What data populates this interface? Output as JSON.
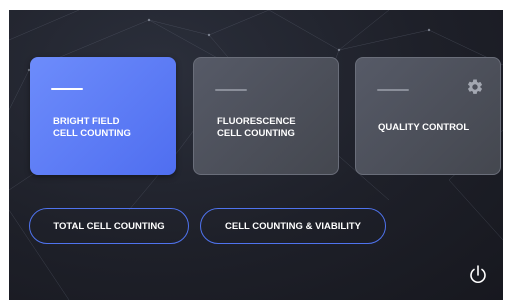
{
  "tiles": [
    {
      "label": "BRIGHT FIELD\nCELL COUNTING",
      "selected": true
    },
    {
      "label": "FLUORESCENCE\nCELL COUNTING",
      "selected": false
    },
    {
      "label": "QUALITY CONTROL",
      "selected": false,
      "icon": "gear-icon"
    }
  ],
  "buttons": {
    "total_cell_counting": "TOTAL CELL COUNTING",
    "cell_counting_viability": "CELL COUNTING & VIABILITY"
  },
  "power_icon": "power-icon",
  "colors": {
    "accent": "#5b7cf6",
    "tile_inactive": "#4d505a",
    "background": "#1e2029",
    "pill_border": "#4f73ee"
  }
}
